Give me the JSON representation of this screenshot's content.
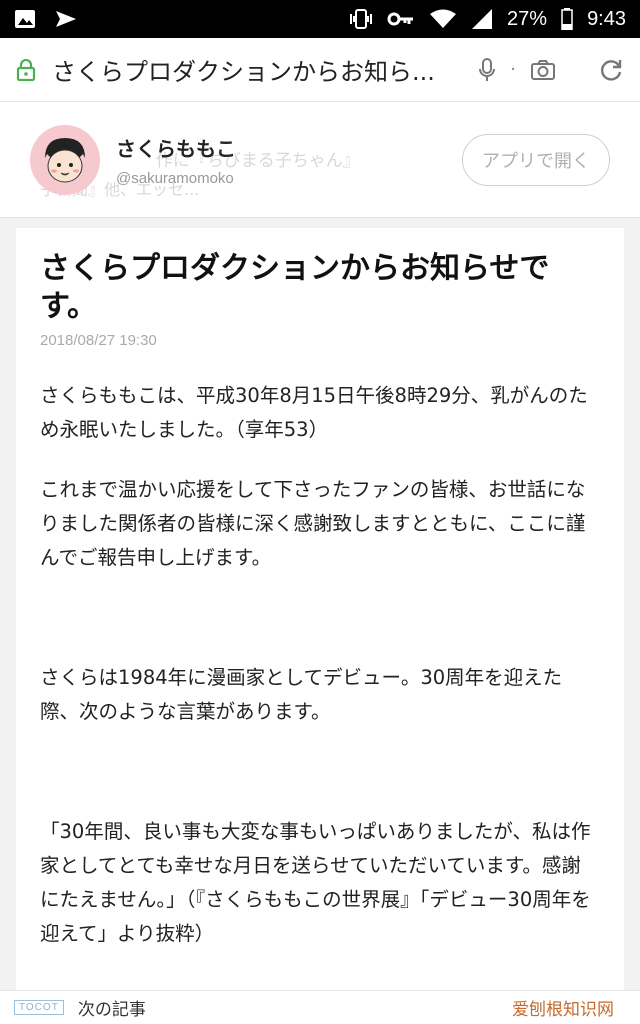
{
  "status_bar": {
    "battery": "27%",
    "time": "9:43",
    "icons": [
      "image-icon",
      "send-icon",
      "vibrate-icon",
      "key-icon",
      "wifi-icon",
      "signal-icon",
      "battery-icon"
    ]
  },
  "url_bar": {
    "title": "さくらプロダクションからお知ら...",
    "icons": [
      "lock-icon",
      "mic-icon",
      "camera-icon",
      "reload-icon"
    ],
    "accent": "#4caf50"
  },
  "profile": {
    "name": "さくらももこ",
    "handle": "@sakuramomoko",
    "bio_line1": "東 　　　　 作に『ちびまる子ちゃん』",
    "bio_line2": "子新聞』他、エッセ...",
    "open_app_label": "アプリで開く"
  },
  "article": {
    "title": "さくらプロダクションからお知らせです。",
    "date": "2018/08/27 19:30",
    "paragraphs": [
      "さくらももこは、平成30年8月15日午後8時29分、乳がんのため永眠いたしました。（享年53）",
      "これまで温かい応援をして下さったファンの皆様、お世話になりました関係者の皆様に深く感謝致しますとともに、ここに謹んでご報告申し上げます。",
      "さくらは1984年に漫画家としてデビュー。30周年を迎えた際、次のような言葉があります。",
      "「30年間、良い事も大変な事もいっぱいありましたが、私は作家としてとても幸せな月日を送らせていただいています。感謝にたえません。」（『さくらももこの世界展』「デビュー30周年を迎えて」より抜粋）"
    ]
  },
  "bottom": {
    "logo": "TOCOT",
    "next_article": "次の記事",
    "watermark": "爱刨根知识网"
  }
}
